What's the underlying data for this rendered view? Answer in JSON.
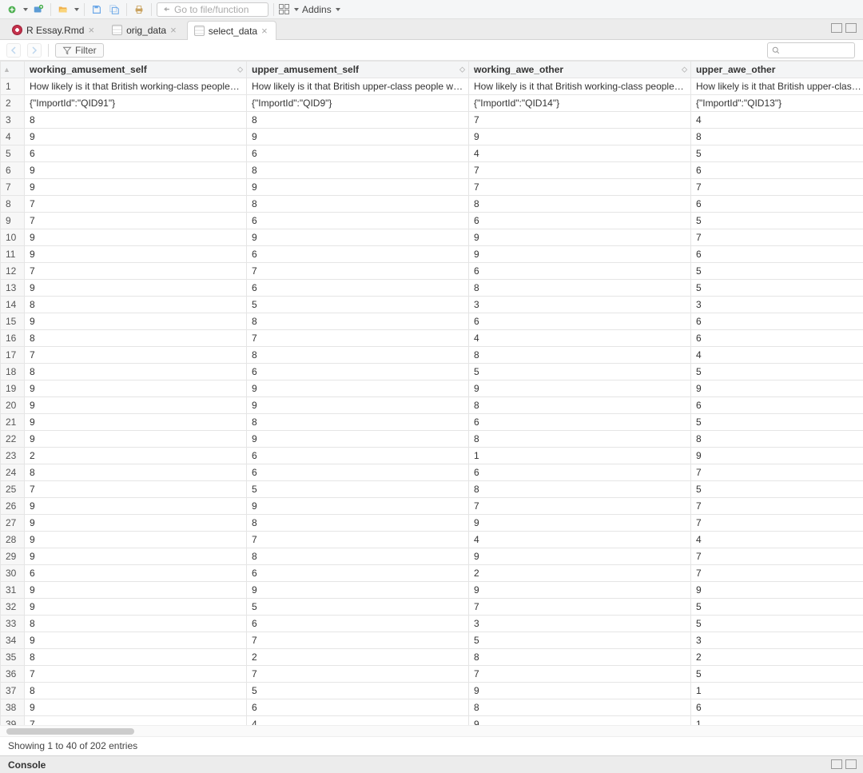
{
  "toolbar": {
    "goto_placeholder": "Go to file/function",
    "addins_label": "Addins"
  },
  "tabs": [
    {
      "label": "R Essay.Rmd",
      "icon": "rmd",
      "active": false
    },
    {
      "label": "orig_data",
      "icon": "df",
      "active": false
    },
    {
      "label": "select_data",
      "icon": "df",
      "active": true
    }
  ],
  "filter_label": "Filter",
  "columns": [
    "working_amusement_self",
    "upper_amusement_self",
    "working_awe_other",
    "upper_awe_other"
  ],
  "rows": [
    [
      "How likely is it that British working-class people would…",
      "How likely is it that British upper-class people would E…",
      "How likely is it that British working-class people would…",
      "How likely is it that British upper-clas…"
    ],
    [
      "{\"ImportId\":\"QID91\"}",
      "{\"ImportId\":\"QID9\"}",
      "{\"ImportId\":\"QID14\"}",
      "{\"ImportId\":\"QID13\"}"
    ],
    [
      "8",
      "8",
      "7",
      "4"
    ],
    [
      "9",
      "9",
      "9",
      "8"
    ],
    [
      "6",
      "6",
      "4",
      "5"
    ],
    [
      "9",
      "8",
      "7",
      "6"
    ],
    [
      "9",
      "9",
      "7",
      "7"
    ],
    [
      "7",
      "8",
      "8",
      "6"
    ],
    [
      "7",
      "6",
      "6",
      "5"
    ],
    [
      "9",
      "9",
      "9",
      "7"
    ],
    [
      "9",
      "6",
      "9",
      "6"
    ],
    [
      "7",
      "7",
      "6",
      "5"
    ],
    [
      "9",
      "6",
      "8",
      "5"
    ],
    [
      "8",
      "5",
      "3",
      "3"
    ],
    [
      "9",
      "8",
      "6",
      "6"
    ],
    [
      "8",
      "7",
      "4",
      "6"
    ],
    [
      "7",
      "8",
      "8",
      "4"
    ],
    [
      "8",
      "6",
      "5",
      "5"
    ],
    [
      "9",
      "9",
      "9",
      "9"
    ],
    [
      "9",
      "9",
      "8",
      "6"
    ],
    [
      "9",
      "8",
      "6",
      "5"
    ],
    [
      "9",
      "9",
      "8",
      "8"
    ],
    [
      "2",
      "6",
      "1",
      "9"
    ],
    [
      "8",
      "6",
      "6",
      "7"
    ],
    [
      "7",
      "5",
      "8",
      "5"
    ],
    [
      "9",
      "9",
      "7",
      "7"
    ],
    [
      "9",
      "8",
      "9",
      "7"
    ],
    [
      "9",
      "7",
      "4",
      "4"
    ],
    [
      "9",
      "8",
      "9",
      "7"
    ],
    [
      "6",
      "6",
      "2",
      "7"
    ],
    [
      "9",
      "9",
      "9",
      "9"
    ],
    [
      "9",
      "5",
      "7",
      "5"
    ],
    [
      "8",
      "6",
      "3",
      "5"
    ],
    [
      "9",
      "7",
      "5",
      "3"
    ],
    [
      "8",
      "2",
      "8",
      "2"
    ],
    [
      "7",
      "7",
      "7",
      "5"
    ],
    [
      "8",
      "5",
      "9",
      "1"
    ],
    [
      "9",
      "6",
      "8",
      "6"
    ],
    [
      "7",
      "4",
      "9",
      "1"
    ]
  ],
  "status_text": "Showing 1 to 40 of 202 entries",
  "console_label": "Console"
}
